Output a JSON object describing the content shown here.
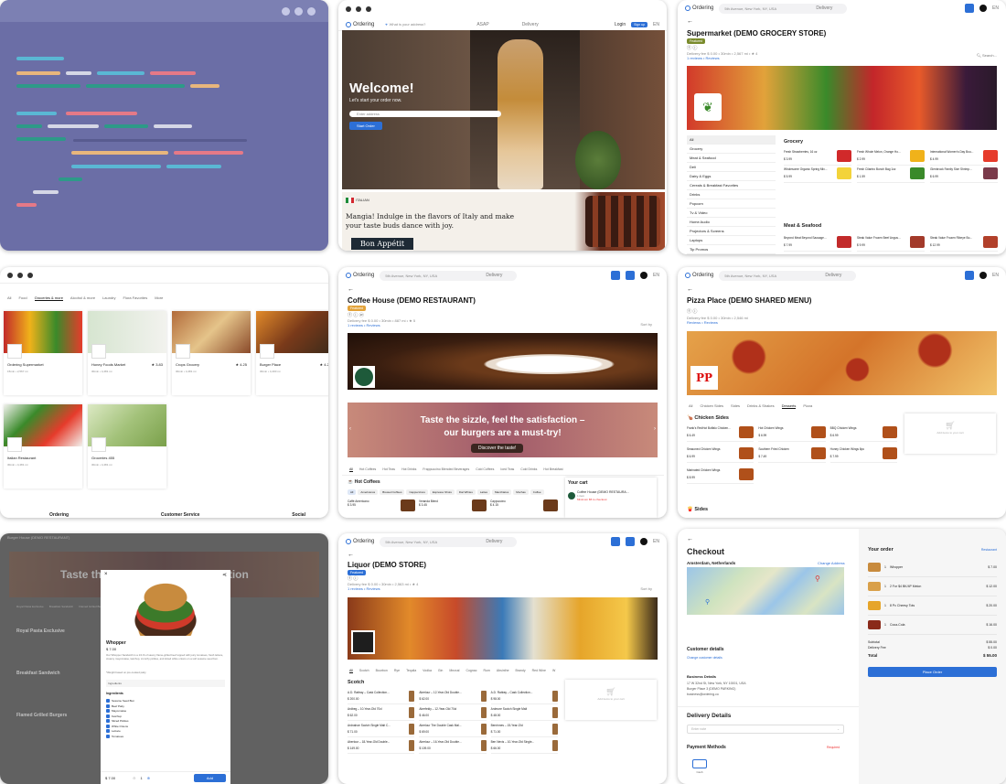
{
  "code_card": {
    "colors": [
      "#5ab7d4",
      "#e8b67c",
      "#d5d7e6",
      "#e57987",
      "#2d9a88",
      "#5ab7d4"
    ]
  },
  "welcome": {
    "brand": "Ordering",
    "search_placeholder": "What is your address?",
    "nav_a": "ASAP",
    "nav_b": "Delivery",
    "login": "Login",
    "signup": "Sign up",
    "lang": "EN",
    "title": "Welcome!",
    "subtitle": "Let's start your order now.",
    "address_placeholder": "Enter address",
    "cta": "Start Order",
    "promo_badge": "ITALIAN",
    "promo_text": "Mangia! Indulge in the flavors of Italy and make your taste buds dance with joy.",
    "promo_button": "Bon Appétit"
  },
  "supermarket": {
    "address": "5th Avenue, New York, NY, USA",
    "nav": "Delivery",
    "title": "Supermarket (DEMO GROCERY STORE)",
    "badge": "Featured",
    "meta": "Delivery fee $ 0.00  •  30min  •  2,567 mi  •  ★ 4",
    "links": "1 reviews  •  Reviews",
    "logo_text": "Ordering",
    "search": "Search...",
    "categories": [
      "All",
      "Grocery",
      "Meat & Seafood",
      "Deli",
      "Dairy & Eggs",
      "Cereals & Breakfast Favorites",
      "Drinks",
      "Popcorn",
      "Tv & Video",
      "Home Audio",
      "Projectors & Screens",
      "Laptops",
      "Tip Promos"
    ],
    "section1": "Grocery",
    "section2": "Meat & Seafood",
    "products": [
      {
        "name": "Fresh Strawberries, 16 oz",
        "price": "$ 3.99"
      },
      {
        "name": "Fresh Whole Melon, Orange Ho...",
        "price": "$ 2.99"
      },
      {
        "name": "International Women's Day Bou...",
        "price": "$ 4.99"
      },
      {
        "name": "Wholesome Organic Spring Mix...",
        "price": "$ 5.99"
      },
      {
        "name": "Fresh Cilantro Bunch Bag 1oz",
        "price": "$ 1.59"
      },
      {
        "name": "Glenbrook Family Size Shrimp...",
        "price": "$ 6.99"
      },
      {
        "name": "Beyond Meat Beyond Sausage...",
        "price": "$ 7.99"
      },
      {
        "name": "Steak Value Frozen Beef Angus...",
        "price": "$ 9.99"
      },
      {
        "name": "Steak Value Frozen Ribeye Bo...",
        "price": "$ 12.99"
      }
    ]
  },
  "marketplace": {
    "tabs": [
      "All",
      "Food",
      "Groceries & more",
      "Alcohol & more",
      "Laundry",
      "Flora Favorites",
      "More"
    ],
    "stores": [
      {
        "name": "Ordering Supermarket",
        "meta": "15min  •  2,567 mi"
      },
      {
        "name": "Honey Foods Market",
        "rating": "3.83",
        "meta": "30min  •  4,481 mi",
        "logo": "HONEY FOODS"
      },
      {
        "name": "Crops Grocery",
        "rating": "4.25",
        "meta": "30min  •  4,481 mi",
        "logo": "Crops"
      },
      {
        "name": "Burger Place",
        "rating": "4.25",
        "meta": "30min  •  4,400 mi"
      },
      {
        "name": "Italian Restaurant",
        "meta": "30min  •  4,481 mi"
      },
      {
        "name": "Groceries 455",
        "meta": "30min  •  4,481 mi"
      }
    ],
    "footer": [
      "Ordering",
      "Customer Service",
      "Social"
    ]
  },
  "coffee": {
    "brand": "Ordering",
    "address": "5th Avenue, New York, NY, USA",
    "nav": "Delivery",
    "title": "Coffee House (DEMO RESTAURANT)",
    "badge": "Featured",
    "meta": "Delivery fee $ 0.00  •  30min  •  887 mi  •  ★ 5",
    "links": "1 reviews  •  Reviews",
    "sort": "Sort by",
    "banner_line1": "Taste the sizzle, feel the satisfaction –",
    "banner_line2": "our burgers are a must-try!",
    "banner_button": "Discover the taste!",
    "tabs": [
      "All",
      "Hot Coffees",
      "Hot Teas",
      "Hot Drinks",
      "Frappuccino Blended Beverages",
      "Cold Coffees",
      "Iced Teas",
      "Cold Drinks",
      "Hot Breakfast"
    ],
    "section": "Hot Coffees",
    "chips": [
      "All",
      "Americanos",
      "Brewed Coffees",
      "Cappuccinos",
      "Espresso Shots",
      "Flat Whites",
      "Lattes",
      "Macchiatos",
      "Mochas",
      "Coffee"
    ],
    "items": [
      {
        "name": "Caffè Americano",
        "price": "$ 3.95"
      },
      {
        "name": "Veranda Blend",
        "price": "$ 3.45"
      },
      {
        "name": "Cappuccino",
        "price": "$ 4.15"
      }
    ],
    "cart_title": "Your cart",
    "cart_store": "Coffee House (DEMO RESTAURA...",
    "cart_items": "1 item",
    "cart_note": "Minimum $5 to checkout"
  },
  "pizza": {
    "brand": "Ordering",
    "address": "5th Avenue, New York, NY, USA",
    "nav": "Delivery",
    "title": "Pizza Place (DEMO SHARED MENU)",
    "meta": "Delivery fee $ 0.00  •  30min  •  2,546 mi",
    "links": "Reviews  •  Reviews",
    "logo_text": "PP",
    "tabs": [
      "All",
      "Chicken Sides",
      "Sides",
      "Drinks & Shakes",
      "Desserts",
      "Pizza"
    ],
    "section1": "Chicken Sides",
    "section2": "Sides",
    "items": [
      {
        "name": "Frank's RedHot Buffalo Chicken...",
        "price": "$ 6.49"
      },
      {
        "name": "Hot Chicken Wings",
        "price": "$ 6.99"
      },
      {
        "name": "BBQ Chicken Wings",
        "price": "$ 6.99"
      },
      {
        "name": "Seasoned Chicken Wings",
        "price": "$ 6.99"
      },
      {
        "name": "Southern Fried Chicken",
        "price": "$ 7.49"
      },
      {
        "name": "Honey Chicken Wings 8pc",
        "price": "$ 7.99"
      },
      {
        "name": "Marinated Chicken Wings",
        "price": "$ 8.99"
      }
    ],
    "cart_note": "Add items to your cart"
  },
  "burger": {
    "store": "Burger House (DEMO RESTAURANT)",
    "product": "Whopper",
    "price": "$ 7.00",
    "desc": "Our Whopper Sandwich is a 1/4 lb of savory flame-grilled beef topped with juicy tomatoes, fresh lettuce, creamy mayonnaise, ketchup, crunchy pickles, and sliced white onions on a soft sesame seed bun.",
    "note": "*Weight based on pre-cooked patty",
    "ingredients_label": "Ingredients",
    "ingredients": [
      "Sesame Seed Bun",
      "Beef Patty",
      "Mayonnaise",
      "Ketchup",
      "Sliced Pickles",
      "White Onions",
      "Lettuce",
      "Tomatoes"
    ],
    "qty": "1",
    "total": "$ 7.00",
    "add": "Add",
    "sections": [
      "Royal Pasta Exclusive",
      "Breakfast Sandwich",
      "Flamed Grilled Burgers"
    ],
    "bg_tabs": [
      "Royal Pasta Exclusive",
      "Breakfast Sandwich",
      "Flamed Grilled Burgers",
      "Chicken & Fish"
    ],
    "banner": "Taste the sizzle, feel the satisfaction"
  },
  "liquor": {
    "brand": "Ordering",
    "address": "5th Avenue, New York, NY, USA",
    "nav": "Delivery",
    "title": "Liquor (DEMO STORE)",
    "badge": "Featured",
    "meta": "Delivery fee $ 0.00  •  30min  •  2,563 mi  •  ★ 4",
    "links": "1 reviews  •  Reviews",
    "sort": "Sort by",
    "tabs": [
      "All",
      "Scotch",
      "Bourbon",
      "Rye",
      "Tequila",
      "Vodka",
      "Gin",
      "Mezcal",
      "Cognac",
      "Rum",
      "Absinthe",
      "Brandy",
      "Red Wine",
      "W"
    ],
    "section": "Scotch",
    "items": [
      {
        "name": "A.D. Rattray – Cask Collection...",
        "price": "$ 200.00"
      },
      {
        "name": "Aberlour – 12-Year-Old Double...",
        "price": "$ 62.00"
      },
      {
        "name": "A.D. Rattray – Cask Collection...",
        "price": "$ 98.00"
      },
      {
        "name": "Ardbeg – 10-Year-Old 70cl",
        "price": "$ 62.00"
      },
      {
        "name": "Aberfeldy – 12-Year-Old 70cl",
        "price": "$ 46.00"
      },
      {
        "name": "Ardmore Scotch Single Malt",
        "price": "$ 48.00"
      },
      {
        "name": "Ardnahoe Scotch Single Malt C...",
        "price": "$ 71.00"
      },
      {
        "name": "Aberlour The Double Cask Mal...",
        "price": "$ 69.00"
      },
      {
        "name": "Benrinnes – 15-Year-Old",
        "price": "$ 71.00"
      },
      {
        "name": "Aberlour – 18-Year-Old Double...",
        "price": "$ 149.00"
      },
      {
        "name": "Aberlour – 16-Year-Old Double...",
        "price": "$ 109.00"
      },
      {
        "name": "Ben Nevis – 10-Year-Old Single...",
        "price": "$ 66.00"
      }
    ],
    "cart_note": "Add items to your cart"
  },
  "checkout": {
    "title": "Checkout",
    "location": "Amsterdam, Netherlands",
    "change_address": "Change Address",
    "customer_details": "Customer details",
    "change_customer": "Change customer details",
    "business_details": "Business Details",
    "business_lines": [
      "17 W 32nd St, New York, NY 10001, USA",
      "Burger Place 3 (DEMO PARKING)",
      "business@ordering.co"
    ],
    "delivery_details": "Delivery Details",
    "delivery_placeholder": "Enter note",
    "payment_methods": "Payment Methods",
    "required": "Required",
    "payment_label": "Cash",
    "your_order": "Your order",
    "restaurant_link": "Restaurant",
    "items": [
      {
        "qty": "1",
        "name": "Whopper",
        "price": "$ 7.00"
      },
      {
        "qty": "1",
        "name": "2 For $4 BK/4P Melon",
        "price": "$ 12.00"
      },
      {
        "qty": "1",
        "name": "8 Pc Cheesy Tots",
        "price": "$ 20.00"
      },
      {
        "qty": "1",
        "name": "Coca-Cola",
        "price": "$ 16.00"
      }
    ],
    "subtotal_label": "Subtotal",
    "subtotal": "$ 55.00",
    "delivery_fee_label": "Delivery Fee",
    "delivery_fee": "$ 0.00",
    "total_label": "Total",
    "total": "$ 55.00",
    "place_order": "Place Order"
  }
}
